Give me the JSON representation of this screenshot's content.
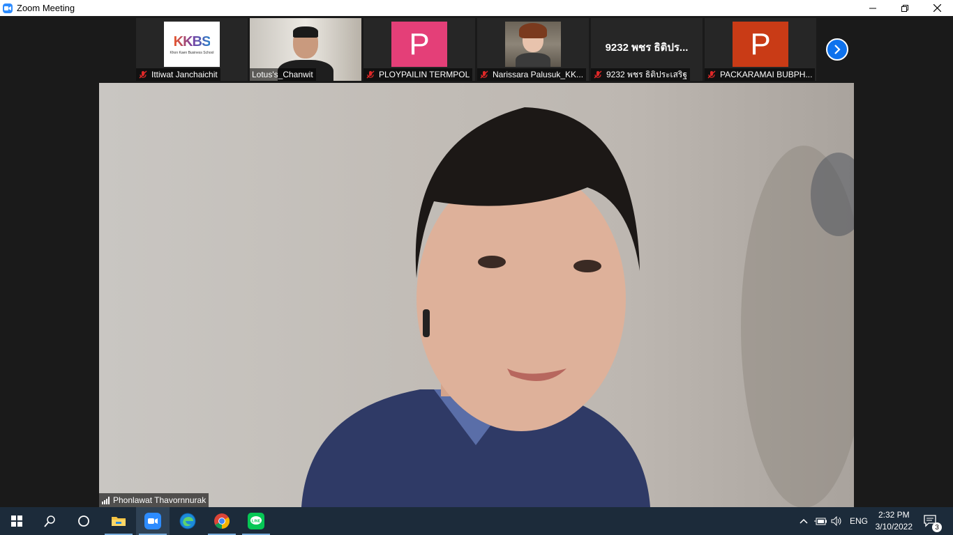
{
  "window": {
    "title": "Zoom Meeting"
  },
  "participants": [
    {
      "name": "Ittiwat Janchaichit",
      "type": "logo",
      "logo_text": "KKBS",
      "logo_sub": "Khon Kaen Business School"
    },
    {
      "name": "Lotus's_Chanwit",
      "type": "video"
    },
    {
      "name": "PLOYPAILIN TERMPOL",
      "type": "initial",
      "initial": "P",
      "color": "#e43f78"
    },
    {
      "name": "Narissara Palusuk_KK...",
      "type": "photo"
    },
    {
      "name": "9232 พชร ธิติประเสริฐ",
      "type": "name-only",
      "display": "9232 พชร ธิติปร..."
    },
    {
      "name": "PACKARAMAI BUBPH...",
      "type": "initial",
      "initial": "P",
      "color": "#c93b16"
    }
  ],
  "active_speaker": {
    "name": "Phonlawat Thavornnurak"
  },
  "taskbar": {
    "language": "ENG",
    "time": "2:32 PM",
    "date": "3/10/2022",
    "notifications": "3"
  }
}
